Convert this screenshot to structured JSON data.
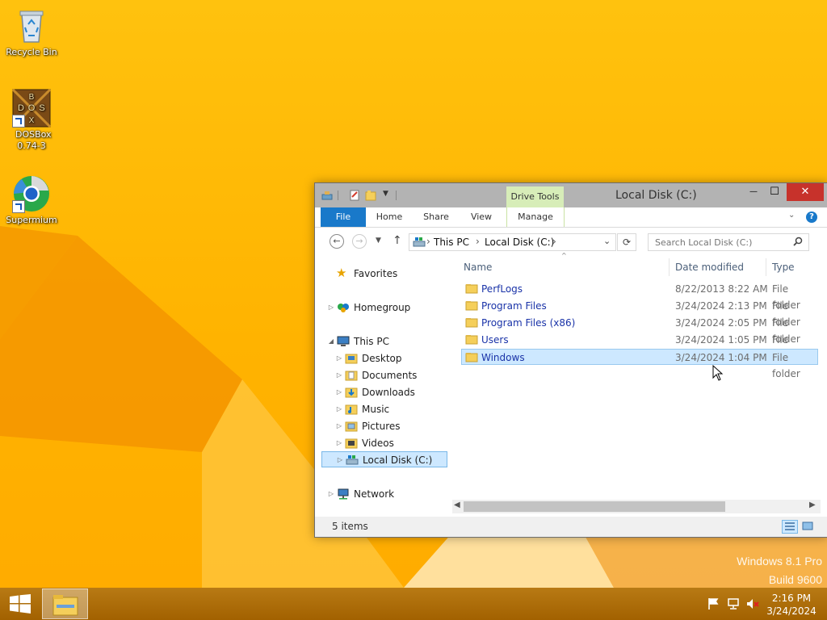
{
  "desktop": {
    "icons": [
      {
        "label": "Recycle Bin"
      },
      {
        "label": "DOSBox 0.74-3"
      },
      {
        "label": "Supermium"
      }
    ],
    "dosbox_logo_letters": [
      "B",
      "D",
      "O",
      "S",
      "X"
    ],
    "watermark": {
      "line1": "Windows 8.1 Pro",
      "line2": "Build 9600"
    }
  },
  "window": {
    "title": "Local Disk (C:)",
    "context_tab": "Drive Tools",
    "controls": {
      "minimize": "—",
      "maximize": "☐",
      "close": "✕"
    },
    "ribbon_tabs": [
      {
        "label": "File"
      },
      {
        "label": "Home"
      },
      {
        "label": "Share"
      },
      {
        "label": "View"
      },
      {
        "label": "Manage"
      }
    ],
    "address": {
      "crumbs": [
        "This PC",
        "Local Disk (C:)"
      ],
      "separator": "›"
    },
    "search": {
      "placeholder": "Search Local Disk (C:)"
    },
    "nav_pane": [
      {
        "label": "Favorites",
        "icon": "star-icon"
      },
      {
        "label": "Homegroup",
        "icon": "homegroup-icon"
      },
      {
        "label": "This PC",
        "icon": "computer-icon"
      },
      {
        "label": "Desktop",
        "icon": "desktop-folder-icon"
      },
      {
        "label": "Documents",
        "icon": "documents-folder-icon"
      },
      {
        "label": "Downloads",
        "icon": "downloads-folder-icon"
      },
      {
        "label": "Music",
        "icon": "music-folder-icon"
      },
      {
        "label": "Pictures",
        "icon": "pictures-folder-icon"
      },
      {
        "label": "Videos",
        "icon": "videos-folder-icon"
      },
      {
        "label": "Local Disk (C:)",
        "icon": "drive-icon"
      },
      {
        "label": "Network",
        "icon": "network-icon"
      }
    ],
    "columns": {
      "name": "Name",
      "date": "Date modified",
      "type": "Type"
    },
    "files": [
      {
        "name": "PerfLogs",
        "date": "8/22/2013 8:22 AM",
        "type": "File folder"
      },
      {
        "name": "Program Files",
        "date": "3/24/2024 2:13 PM",
        "type": "File folder"
      },
      {
        "name": "Program Files (x86)",
        "date": "3/24/2024 2:05 PM",
        "type": "File folder"
      },
      {
        "name": "Users",
        "date": "3/24/2024 1:05 PM",
        "type": "File folder"
      },
      {
        "name": "Windows",
        "date": "3/24/2024 1:04 PM",
        "type": "File folder"
      }
    ],
    "status": "5 items"
  },
  "taskbar": {
    "time": "2:16 PM",
    "date": "3/24/2024"
  },
  "colors": {
    "accent": "#1979ca",
    "close": "#c7322b",
    "selection": "#cde8ff",
    "link": "#1a33a8"
  }
}
